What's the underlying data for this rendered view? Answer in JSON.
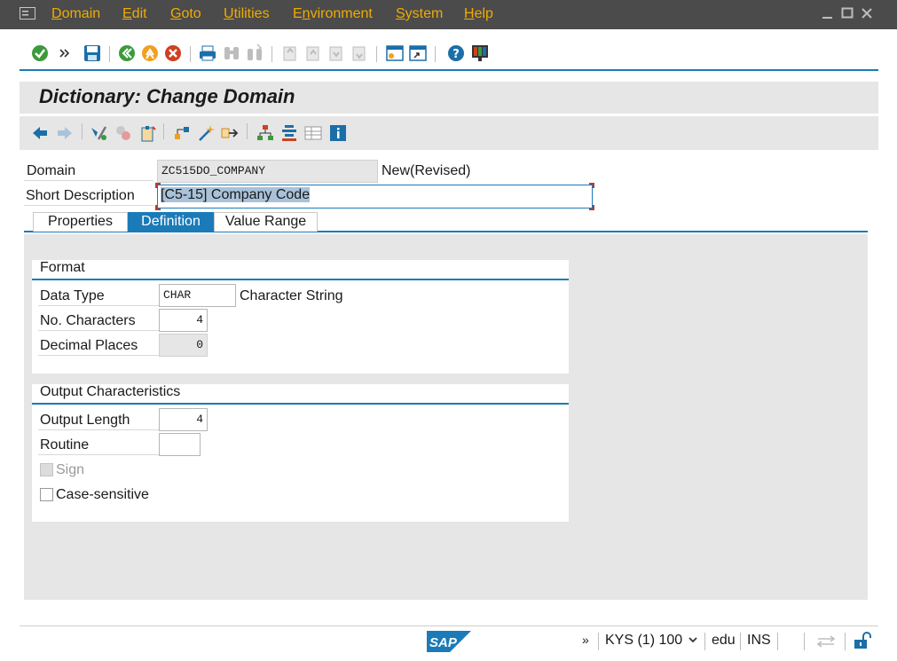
{
  "menubar": {
    "items": [
      "Domain",
      "Edit",
      "Goto",
      "Utilities",
      "Environment",
      "System",
      "Help"
    ],
    "underline": [
      "D",
      "E",
      "G",
      "U",
      "n",
      "S",
      "H"
    ]
  },
  "title": "Dictionary: Change Domain",
  "header": {
    "domain_label": "Domain",
    "domain_value": "ZC515DO_COMPANY",
    "domain_status": "New(Revised)",
    "short_desc_label": "Short Description",
    "short_desc_value": "[C5-15] Company Code"
  },
  "tabs": {
    "properties": "Properties",
    "definition": "Definition",
    "value_range": "Value Range",
    "active": "definition"
  },
  "format": {
    "title": "Format",
    "data_type_label": "Data Type",
    "data_type_value": "CHAR",
    "data_type_desc": "Character String",
    "no_chars_label": "No. Characters",
    "no_chars_value": "4",
    "decimal_label": "Decimal Places",
    "decimal_value": "0"
  },
  "output": {
    "title": "Output Characteristics",
    "output_length_label": "Output Length",
    "output_length_value": "4",
    "routine_label": "Routine",
    "routine_value": "",
    "sign_label": "Sign",
    "sign_checked": false,
    "case_label": "Case-sensitive",
    "case_checked": false
  },
  "status": {
    "logo": "SAP",
    "system": "KYS (1) 100",
    "server": "edu",
    "mode": "INS"
  },
  "colors": {
    "menubar_bg": "#4b4b4b",
    "menu_text": "#f0ab00",
    "accent": "#1b7bb8",
    "panel_bg": "#e6e6e6"
  }
}
